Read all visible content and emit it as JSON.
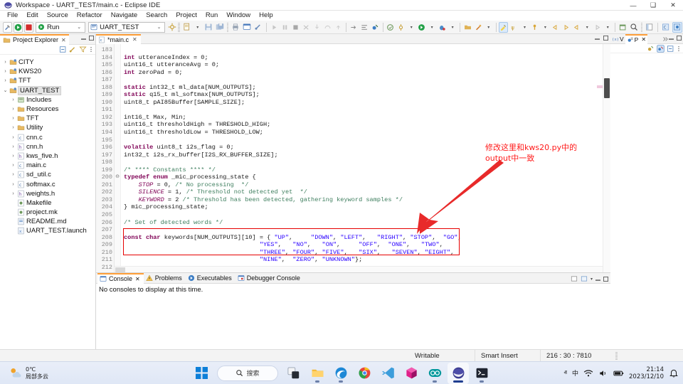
{
  "window": {
    "title": "Workspace - UART_TEST/main.c - Eclipse IDE",
    "app_icon": "eclipse-icon",
    "minimize": "—",
    "maximize": "❑",
    "close": "✕"
  },
  "menubar": {
    "items": [
      "File",
      "Edit",
      "Source",
      "Refactor",
      "Navigate",
      "Search",
      "Project",
      "Run",
      "Window",
      "Help"
    ]
  },
  "toolbar": {
    "run_config_label": "Run",
    "project_label": "UART_TEST",
    "chevron": "⌄",
    "buttons": [
      "build-icon",
      "run-icon",
      "stop-icon",
      "new-icon",
      "save-icon",
      "save-all-icon",
      "print-icon",
      "console-icon",
      "link-icon",
      "resume-icon",
      "suspend-icon",
      "terminate-icon",
      "disconnect-icon",
      "step-into-icon",
      "step-over-icon",
      "step-return-icon",
      "drop-to-frame-icon",
      "toggle-icon",
      "skip-breakpoints-icon",
      "debug-icon",
      "external-tools-icon",
      "search-icon",
      "perspective-icon"
    ]
  },
  "project_explorer": {
    "tab_label": "Project Explorer",
    "close_glyph": "✕",
    "tree": [
      {
        "label": "CITY",
        "indent": 0,
        "arrow": "›",
        "icon": "c-project-icon",
        "selected": false
      },
      {
        "label": "KWS20",
        "indent": 0,
        "arrow": "›",
        "icon": "c-project-icon",
        "selected": false
      },
      {
        "label": "TFT",
        "indent": 0,
        "arrow": "›",
        "icon": "c-project-icon",
        "selected": false
      },
      {
        "label": "UART_TEST",
        "indent": 0,
        "arrow": "⌄",
        "icon": "c-project-icon",
        "selected": true
      },
      {
        "label": "Includes",
        "indent": 1,
        "arrow": "›",
        "icon": "includes-icon",
        "selected": false
      },
      {
        "label": "Resources",
        "indent": 1,
        "arrow": "›",
        "icon": "folder-icon",
        "selected": false
      },
      {
        "label": "TFT",
        "indent": 1,
        "arrow": "›",
        "icon": "folder-icon",
        "selected": false
      },
      {
        "label": "Utility",
        "indent": 1,
        "arrow": "›",
        "icon": "folder-icon",
        "selected": false
      },
      {
        "label": "cnn.c",
        "indent": 1,
        "arrow": "›",
        "icon": "c-file-icon",
        "selected": false
      },
      {
        "label": "cnn.h",
        "indent": 1,
        "arrow": "›",
        "icon": "h-file-icon",
        "selected": false
      },
      {
        "label": "kws_five.h",
        "indent": 1,
        "arrow": "›",
        "icon": "h-file-icon",
        "selected": false
      },
      {
        "label": "main.c",
        "indent": 1,
        "arrow": "›",
        "icon": "c-file-icon",
        "selected": false
      },
      {
        "label": "sd_util.c",
        "indent": 1,
        "arrow": "›",
        "icon": "c-file-icon",
        "selected": false
      },
      {
        "label": "softmax.c",
        "indent": 1,
        "arrow": "›",
        "icon": "c-file-icon",
        "selected": false
      },
      {
        "label": "weights.h",
        "indent": 1,
        "arrow": "›",
        "icon": "h-file-icon",
        "selected": false
      },
      {
        "label": "Makefile",
        "indent": 1,
        "arrow": "",
        "icon": "make-file-icon",
        "selected": false
      },
      {
        "label": "project.mk",
        "indent": 1,
        "arrow": "",
        "icon": "mk-file-icon",
        "selected": false
      },
      {
        "label": "README.md",
        "indent": 1,
        "arrow": "",
        "icon": "md-file-icon",
        "selected": false
      },
      {
        "label": "UART_TEST.launch",
        "indent": 1,
        "arrow": "",
        "icon": "launch-file-icon",
        "selected": false
      }
    ]
  },
  "editor": {
    "tab_label": "*main.c",
    "close_glyph": "✕",
    "first_line_number": 183,
    "lines": [
      {
        "n": 183,
        "fold": "",
        "html": ""
      },
      {
        "n": 184,
        "fold": "",
        "html": "<span class=\"kw\">int</span> utteranceIndex = 0;"
      },
      {
        "n": 185,
        "fold": "",
        "html": "uint16_t utteranceAvg = 0;"
      },
      {
        "n": 186,
        "fold": "",
        "html": "<span class=\"kw\">int</span> zeroPad = 0;"
      },
      {
        "n": 187,
        "fold": "",
        "html": ""
      },
      {
        "n": 188,
        "fold": "",
        "html": "<span class=\"kw\">static</span> int32_t ml_data[NUM_OUTPUTS];"
      },
      {
        "n": 189,
        "fold": "",
        "html": "<span class=\"kw\">static</span> q15_t ml_softmax[NUM_OUTPUTS];"
      },
      {
        "n": 190,
        "fold": "",
        "html": "uint8_t pAI85Buffer[SAMPLE_SIZE];"
      },
      {
        "n": 191,
        "fold": "",
        "html": ""
      },
      {
        "n": 192,
        "fold": "",
        "html": "int16_t Max, Min;"
      },
      {
        "n": 193,
        "fold": "",
        "html": "uint16_t thresholdHigh = THRESHOLD_HIGH;"
      },
      {
        "n": 194,
        "fold": "",
        "html": "uint16_t thresholdLow = THRESHOLD_LOW;"
      },
      {
        "n": 195,
        "fold": "",
        "html": ""
      },
      {
        "n": 196,
        "fold": "",
        "html": "<span class=\"kw\">volatile</span> uint8_t i2s_flag = 0;"
      },
      {
        "n": 197,
        "fold": "",
        "html": "int32_t i2s_rx_buffer[I2S_RX_BUFFER_SIZE];"
      },
      {
        "n": 198,
        "fold": "",
        "html": ""
      },
      {
        "n": 199,
        "fold": "",
        "html": "<span class=\"cm\">/* **** Constants **** */</span>"
      },
      {
        "n": 200,
        "fold": "⊖",
        "html": "<span class=\"kw\">typedef enum</span> _mic_processing_state {"
      },
      {
        "n": 201,
        "fold": "",
        "html": "    <span class=\"en\">STOP</span> = 0, <span class=\"cm\">/* No processing  */</span>"
      },
      {
        "n": 202,
        "fold": "",
        "html": "    <span class=\"en\">SILENCE</span> = 1, <span class=\"cm\">/* Threshold not detected yet  */</span>"
      },
      {
        "n": 203,
        "fold": "",
        "html": "    <span class=\"en\">KEYWORD</span> = 2 <span class=\"cm\">/* Threshold has been detected, gathering keyword samples */</span>"
      },
      {
        "n": 204,
        "fold": "",
        "html": "} mic_processing_state;"
      },
      {
        "n": 205,
        "fold": "",
        "html": ""
      },
      {
        "n": 206,
        "fold": "",
        "html": "<span class=\"cm\">/* Set of detected words */</span>"
      },
      {
        "n": 207,
        "fold": "",
        "html": ""
      },
      {
        "n": 208,
        "fold": "",
        "html": "<span class=\"kw\">const char</span> keywords[NUM_OUTPUTS][10] = { <span class=\"st\">\"UP\"</span>,     <span class=\"st\">\"DOWN\"</span>, <span class=\"st\">\"LEFT\"</span>,   <span class=\"st\">\"RIGHT\"</span>, <span class=\"st\">\"STOP\"</span>,  <span class=\"st\">\"GO\"</span>,"
      },
      {
        "n": 209,
        "fold": "",
        "html": "                                     <span class=\"st\">\"YES\"</span>,   <span class=\"st\">\"NO\"</span>,   <span class=\"st\">\"ON\"</span>,     <span class=\"st\">\"OFF\"</span>,  <span class=\"st\">\"ONE\"</span>,   <span class=\"st\">\"TWO\"</span>,"
      },
      {
        "n": 210,
        "fold": "",
        "html": "                                     <span class=\"st\">\"THREE\"</span>, <span class=\"st\">\"FOUR\"</span>, <span class=\"st\">\"FIVE\"</span>,   <span class=\"st\">\"SIX\"</span>,   <span class=\"st\">\"SEVEN\"</span>, <span class=\"st\">\"EIGHT\"</span>,"
      },
      {
        "n": 211,
        "fold": "",
        "html": "                                     <span class=\"st\">\"NINE\"</span>,  <span class=\"st\">\"ZERO\"</span>, <span class=\"st\">\"UNKNOWN\"</span>};"
      },
      {
        "n": 212,
        "fold": "",
        "html": ""
      }
    ],
    "keywords_array": [
      "UP",
      "DOWN",
      "LEFT",
      "RIGHT",
      "STOP",
      "GO",
      "YES",
      "NO",
      "ON",
      "OFF",
      "ONE",
      "TWO",
      "THREE",
      "FOUR",
      "FIVE",
      "SIX",
      "SEVEN",
      "EIGHT",
      "NINE",
      "ZERO",
      "UNKNOWN"
    ]
  },
  "annotation": {
    "line1": "修改这里和kws20.py中的",
    "line2": "output中一致",
    "color": "#ff1a1a",
    "arrow": "red-arrow-annotation",
    "highlight_box": "red-rectangle-highlight"
  },
  "right_panel": {
    "tabs": [
      {
        "label": "V",
        "icon": "variables-icon",
        "active": false
      },
      {
        "label": "P",
        "icon": "breakpoints-icon",
        "active": true
      }
    ],
    "close_glyph": "✕"
  },
  "console": {
    "tabs": [
      {
        "label": "Console",
        "icon": "console-icon",
        "active": true,
        "closable": true
      },
      {
        "label": "Problems",
        "icon": "problems-icon",
        "active": false,
        "closable": false
      },
      {
        "label": "Executables",
        "icon": "executables-icon",
        "active": false,
        "closable": false
      },
      {
        "label": "Debugger Console",
        "icon": "debugger-console-icon",
        "active": false,
        "closable": false
      }
    ],
    "empty_message": "No consoles to display at this time."
  },
  "statusbar": {
    "writable": "Writable",
    "insert_mode": "Smart Insert",
    "position": "216 : 30 : 7810"
  },
  "taskbar": {
    "weather": {
      "temp": "0℃",
      "condition": "局部多云",
      "icon": "weather-partly-cloudy-icon"
    },
    "search_placeholder": "搜索",
    "apps": [
      {
        "name": "start-button",
        "icon": "windows-start-icon",
        "running": false,
        "active": false
      },
      {
        "name": "search-pill",
        "icon": "search-icon",
        "running": false,
        "active": false
      },
      {
        "name": "task-view",
        "icon": "task-view-icon",
        "running": false,
        "active": false
      },
      {
        "name": "file-explorer",
        "icon": "file-explorer-icon",
        "running": true,
        "active": false
      },
      {
        "name": "edge",
        "icon": "edge-icon",
        "running": true,
        "active": false
      },
      {
        "name": "chrome",
        "icon": "chrome-icon",
        "running": false,
        "active": false
      },
      {
        "name": "vscode",
        "icon": "vscode-icon",
        "running": false,
        "active": false
      },
      {
        "name": "cube-app",
        "icon": "cube-icon",
        "running": false,
        "active": false
      },
      {
        "name": "arduino",
        "icon": "arduino-icon",
        "running": true,
        "active": false
      },
      {
        "name": "eclipse",
        "icon": "eclipse-icon",
        "running": true,
        "active": true
      },
      {
        "name": "terminal",
        "icon": "terminal-icon",
        "running": true,
        "active": false
      }
    ],
    "tray": {
      "chevron": "ⱏ",
      "ime": "中",
      "wifi": "wifi-icon",
      "volume": "volume-icon",
      "battery": "battery-icon",
      "time": "21:14",
      "date": "2023/12/10",
      "notifications": "notification-bell-icon"
    }
  }
}
